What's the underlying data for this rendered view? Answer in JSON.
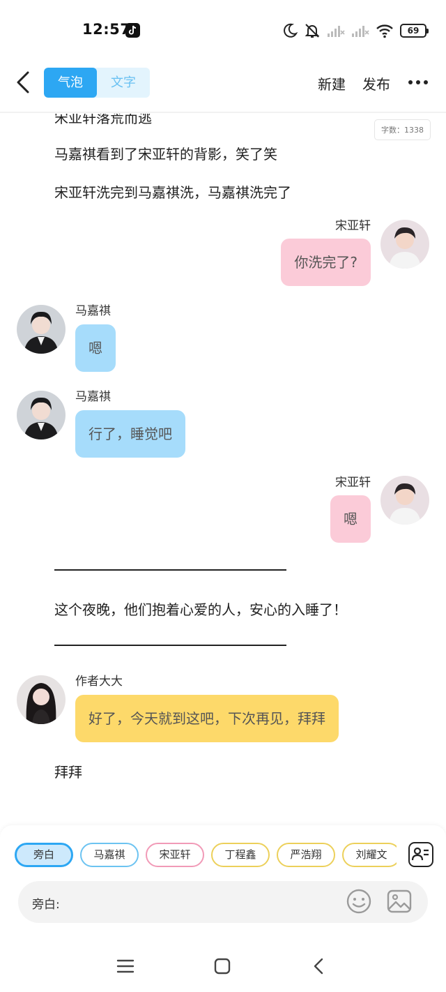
{
  "status_bar": {
    "time": "12:57",
    "battery": "69"
  },
  "header": {
    "tabs": [
      {
        "label": "气泡",
        "active": true
      },
      {
        "label": "文字",
        "active": false
      }
    ],
    "new_label": "新建",
    "publish_label": "发布"
  },
  "word_count": "字数：1338",
  "messages": {
    "narr_partial": "宋亚轩落荒而逃",
    "narr_1": "马嘉祺看到了宋亚轩的背影，笑了笑",
    "narr_2": "宋亚轩洗完到马嘉祺洗，马嘉祺洗完了",
    "msg_1": {
      "name": "宋亚轩",
      "text": "你洗完了?"
    },
    "msg_2": {
      "name": "马嘉祺",
      "text": "嗯"
    },
    "msg_3": {
      "name": "马嘉祺",
      "text": "行了，睡觉吧"
    },
    "msg_4": {
      "name": "宋亚轩",
      "text": "嗯"
    },
    "narr_3": "这个夜晚，他们抱着心爱的人，安心的入睡了！",
    "msg_5": {
      "name": "作者大大",
      "text": "好了，今天就到这吧，下次再见，拜拜"
    },
    "narr_4": "拜拜"
  },
  "characters": [
    "旁白",
    "马嘉祺",
    "宋亚轩",
    "丁程鑫",
    "严浩翔",
    "刘耀文"
  ],
  "input": {
    "label": "旁白:"
  },
  "colors": {
    "accent": "#2da7f3",
    "pink_bubble": "#fbcbd8",
    "blue_bubble": "#a6dcfb",
    "yellow_bubble": "#fdd96a"
  },
  "icons": {
    "back": "chevron-left-icon",
    "more": "more-dots-icon",
    "roles": "contact-card-icon",
    "emoji": "smiley-icon",
    "image": "image-icon"
  }
}
